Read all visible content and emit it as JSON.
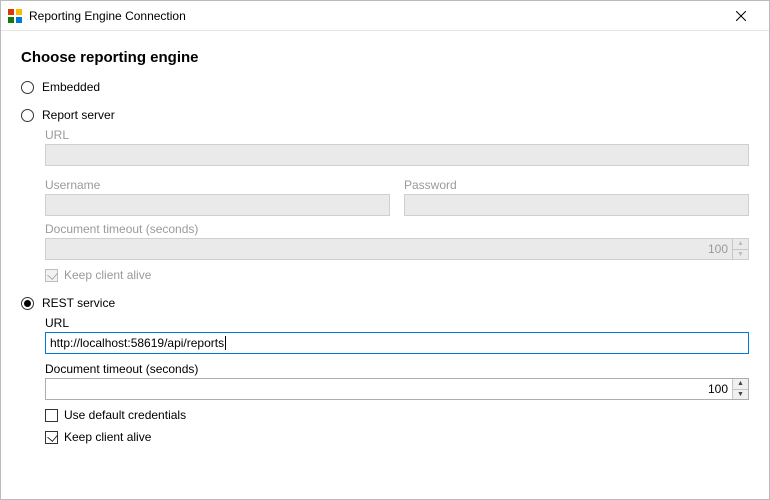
{
  "window": {
    "title": "Reporting Engine Connection"
  },
  "heading": "Choose reporting engine",
  "options": {
    "embedded": {
      "label": "Embedded",
      "selected": false
    },
    "report_server": {
      "label": "Report server",
      "selected": false,
      "url_label": "URL",
      "url_value": "",
      "username_label": "Username",
      "username_value": "",
      "password_label": "Password",
      "password_value": "",
      "timeout_label": "Document timeout (seconds)",
      "timeout_value": "100",
      "keep_alive_label": "Keep client alive",
      "keep_alive_checked": true
    },
    "rest_service": {
      "label": "REST service",
      "selected": true,
      "url_label": "URL",
      "url_value": "http://localhost:58619/api/reports",
      "timeout_label": "Document timeout (seconds)",
      "timeout_value": "100",
      "use_default_credentials_label": "Use default credentials",
      "use_default_credentials_checked": false,
      "keep_alive_label": "Keep client alive",
      "keep_alive_checked": true
    }
  }
}
